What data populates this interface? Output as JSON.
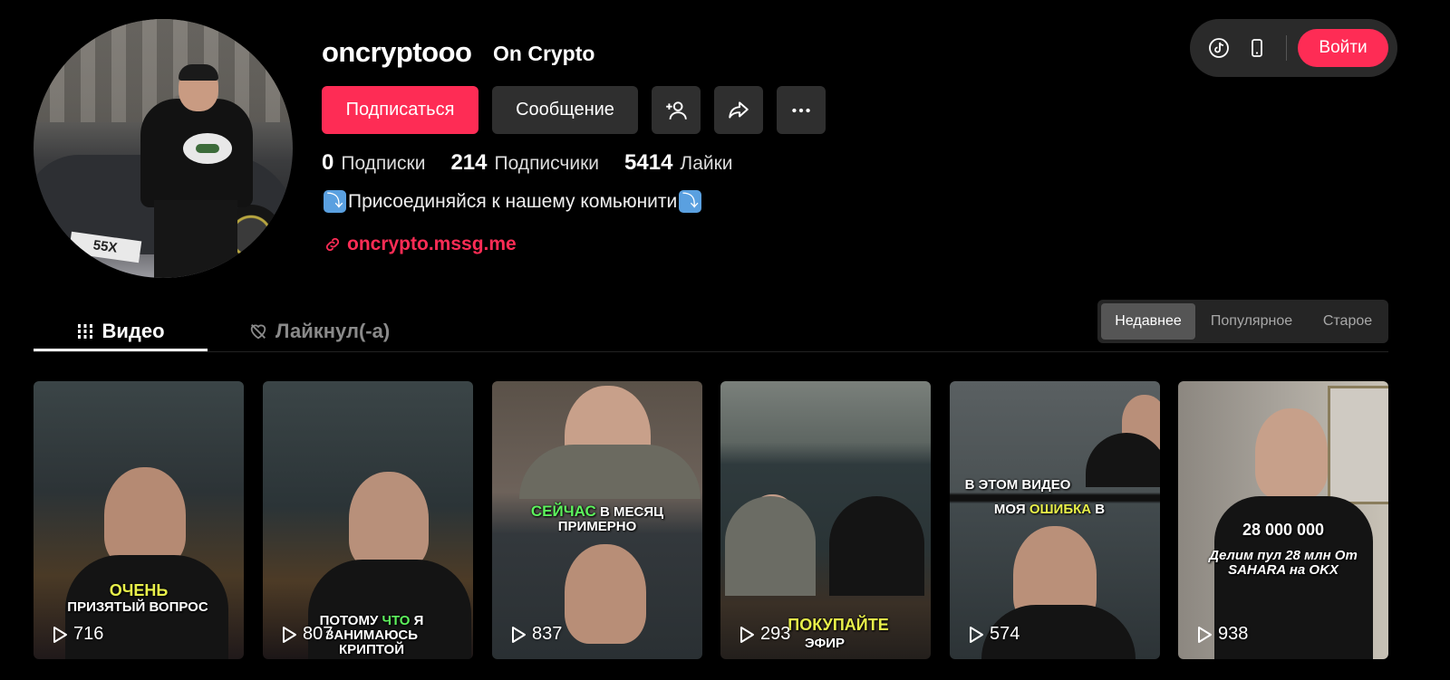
{
  "profile": {
    "username": "oncryptooo",
    "nickname": "On Crypto",
    "avatar_plate": "55X",
    "follow_label": "Подписаться",
    "message_label": "Сообщение",
    "stats": [
      {
        "value": "0",
        "label": "Подписки"
      },
      {
        "value": "214",
        "label": "Подписчики"
      },
      {
        "value": "5414",
        "label": "Лайки"
      }
    ],
    "bio": "Присоединяйся к нашему комьюнити",
    "bio_emoji": "⤵",
    "link": "oncrypto.mssg.me"
  },
  "topbar": {
    "login_label": "Войти",
    "icons": [
      "tiktok-icon",
      "mobile-icon"
    ]
  },
  "tabs": [
    {
      "label": "Видео",
      "active": true
    },
    {
      "label": "Лайкнул(-а)",
      "active": false
    }
  ],
  "sort": {
    "options": [
      "Недавнее",
      "Популярное",
      "Старое"
    ],
    "selected": "Недавнее"
  },
  "videos": [
    {
      "views": "716",
      "caption_parts": [
        {
          "text": "ОЧЕНЬ",
          "color": "y"
        },
        {
          "text": "ПРИЗЯТЫЙ ВОПРОС",
          "color": "w"
        }
      ]
    },
    {
      "views": "807",
      "caption_parts": [
        {
          "text": "ПОТОМУ ",
          "color": "w"
        },
        {
          "text": "ЧТО",
          "color": "g"
        },
        {
          "text": " Я ЗАНИМАЮСЬ КРИПТОЙ",
          "color": "w"
        }
      ]
    },
    {
      "views": "837",
      "caption_parts": [
        {
          "text": "СЕЙЧАС",
          "color": "g"
        },
        {
          "text": " В МЕСЯЦ ПРИМЕРНО",
          "color": "w"
        }
      ]
    },
    {
      "views": "293",
      "caption_parts": [
        {
          "text": "ПОКУПАЙТЕ",
          "color": "y"
        },
        {
          "text": " ЭФИР",
          "color": "w"
        }
      ]
    },
    {
      "views": "574",
      "caption_parts": [
        {
          "text": "В ЭТОМ ВИДЕО",
          "color": "w"
        },
        {
          "text": " МОЯ ",
          "color": "w"
        },
        {
          "text": "ОШИБКА",
          "color": "y"
        },
        {
          "text": " В",
          "color": "w"
        }
      ]
    },
    {
      "views": "938",
      "caption_parts": [
        {
          "text": "28 000 000",
          "color": "w"
        },
        {
          "text": "Делим пул 28 млн От SAHARA на OKX",
          "color": "w"
        }
      ]
    }
  ],
  "colors": {
    "accent": "#fe2c55",
    "bg": "#000000",
    "button_dark": "#2f2f2f"
  }
}
